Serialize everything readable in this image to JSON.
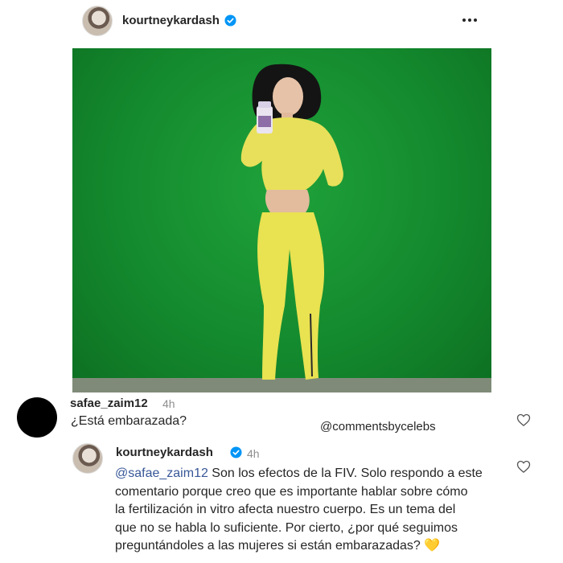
{
  "post": {
    "username": "kourtneykardash",
    "more_icon": "more-horizontal-icon",
    "verified_color": "#0095f6"
  },
  "comments": [
    {
      "username": "safae_zaim12",
      "time": "4h",
      "text": "¿Está embarazada?"
    },
    {
      "username": "kourtneykardash",
      "time": "4h",
      "mention": "@safae_zaim12",
      "lines": [
        " Son los efectos de la FIV.  Solo respondo a este",
        "comentario porque creo que es importante hablar sobre cómo",
        "la fertilización in vitro afecta nuestro cuerpo. Es un tema del",
        "que no se habla lo suficiente. Por cierto, ¿por qué seguimos",
        "preguntándoles a las mujeres si están embarazadas? 💛"
      ]
    }
  ],
  "watermark": "@commentsbycelebs"
}
